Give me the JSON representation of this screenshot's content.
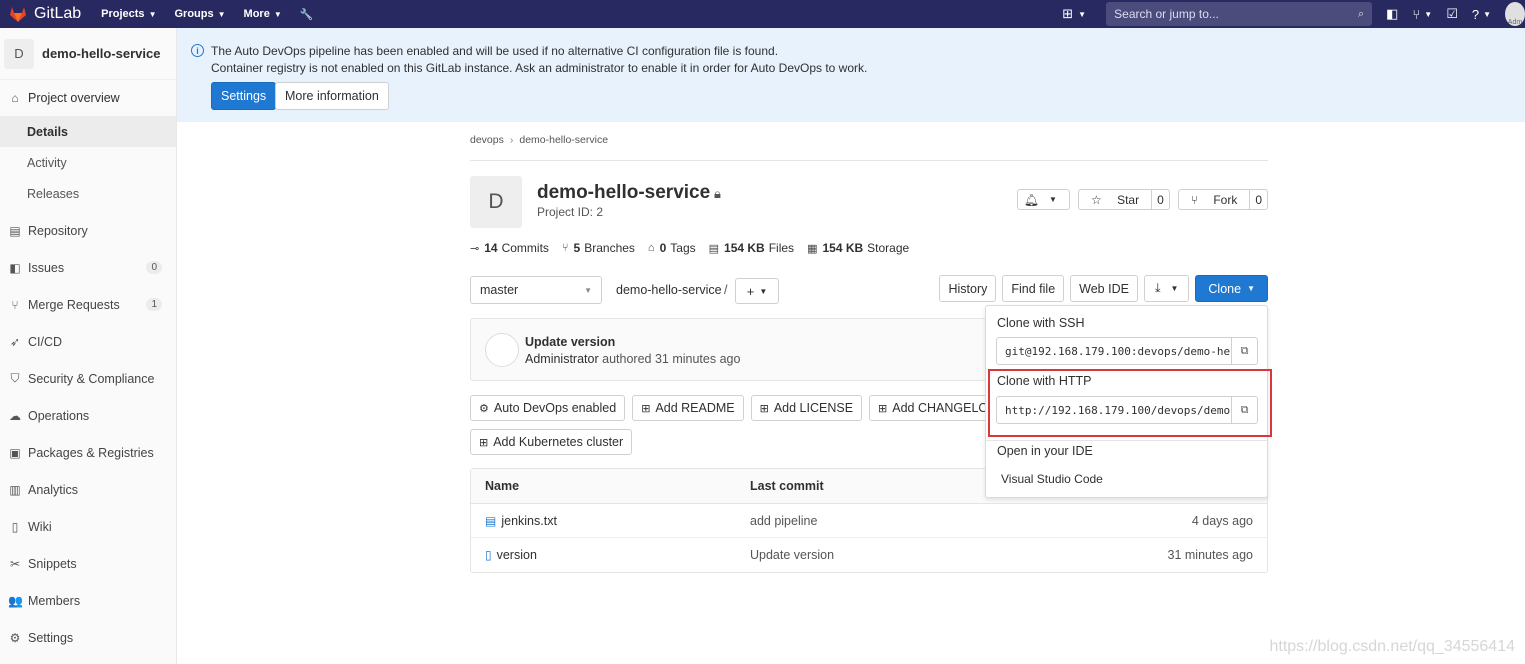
{
  "navbar": {
    "brand": "GitLab",
    "menu": [
      {
        "label": "Projects"
      },
      {
        "label": "Groups"
      },
      {
        "label": "More"
      }
    ],
    "search_placeholder": "Search or jump to...",
    "avatar_label": "Adm"
  },
  "sidebar": {
    "project_initial": "D",
    "project_name": "demo-hello-service",
    "overview": "Project overview",
    "sub_items": [
      "Details",
      "Activity",
      "Releases"
    ],
    "items": [
      {
        "label": "Repository",
        "icon": "doc-icon"
      },
      {
        "label": "Issues",
        "icon": "issues-icon",
        "count": "0"
      },
      {
        "label": "Merge Requests",
        "icon": "merge-icon",
        "count": "1"
      },
      {
        "label": "CI/CD",
        "icon": "rocket-icon"
      },
      {
        "label": "Security & Compliance",
        "icon": "shield-icon"
      },
      {
        "label": "Operations",
        "icon": "cloud-icon"
      },
      {
        "label": "Packages & Registries",
        "icon": "package-icon"
      },
      {
        "label": "Analytics",
        "icon": "chart-icon"
      },
      {
        "label": "Wiki",
        "icon": "book-icon"
      },
      {
        "label": "Snippets",
        "icon": "scissors-icon"
      },
      {
        "label": "Members",
        "icon": "users-icon"
      },
      {
        "label": "Settings",
        "icon": "gear-icon"
      }
    ]
  },
  "banner": {
    "line1": "The Auto DevOps pipeline has been enabled and will be used if no alternative CI configuration file is found.",
    "line2": "Container registry is not enabled on this GitLab instance. Ask an administrator to enable it in order for Auto DevOps to work.",
    "settings_btn": "Settings",
    "more_info_btn": "More information"
  },
  "breadcrumb": {
    "group": "devops",
    "project": "demo-hello-service"
  },
  "project": {
    "initial": "D",
    "title": "demo-hello-service",
    "id_label": "Project ID: 2",
    "star_label": "Star",
    "star_count": "0",
    "fork_label": "Fork",
    "fork_count": "0"
  },
  "stats": {
    "commits_n": "14",
    "commits_label": "Commits",
    "branches_n": "5",
    "branches_label": "Branches",
    "tags_n": "0",
    "tags_label": "Tags",
    "files_n": "154 KB",
    "files_label": "Files",
    "storage_n": "154 KB",
    "storage_label": "Storage"
  },
  "repo_bar": {
    "branch": "master",
    "path": "demo-hello-service",
    "sep": "/",
    "history": "History",
    "find_file": "Find file",
    "web_ide": "Web IDE",
    "clone": "Clone"
  },
  "commit": {
    "title": "Update version",
    "author": "Administrator",
    "meta": "authored 31 minutes ago"
  },
  "quick_actions": [
    "Auto DevOps enabled",
    "Add README",
    "Add LICENSE",
    "Add CHANGELOG"
  ],
  "quick_actions_2": "Add Kubernetes cluster",
  "files": {
    "headers": [
      "Name",
      "Last commit"
    ],
    "rows": [
      {
        "name": "jenkins.txt",
        "commit": "add pipeline",
        "date": "4 days ago"
      },
      {
        "name": "version",
        "commit": "Update version",
        "date": "31 minutes ago"
      }
    ]
  },
  "clone_dropdown": {
    "ssh_label": "Clone with SSH",
    "ssh_url": "git@192.168.179.100:devops/demo-he",
    "http_label": "Clone with HTTP",
    "http_url": "http://192.168.179.100/devops/demo",
    "ide_label": "Open in your IDE",
    "ide_option": "Visual Studio Code"
  },
  "watermark": "https://blog.csdn.net/qq_34556414",
  "colors": {
    "navbar": "#292961",
    "primary": "#1f78d1",
    "highlight": "#d9363e"
  }
}
